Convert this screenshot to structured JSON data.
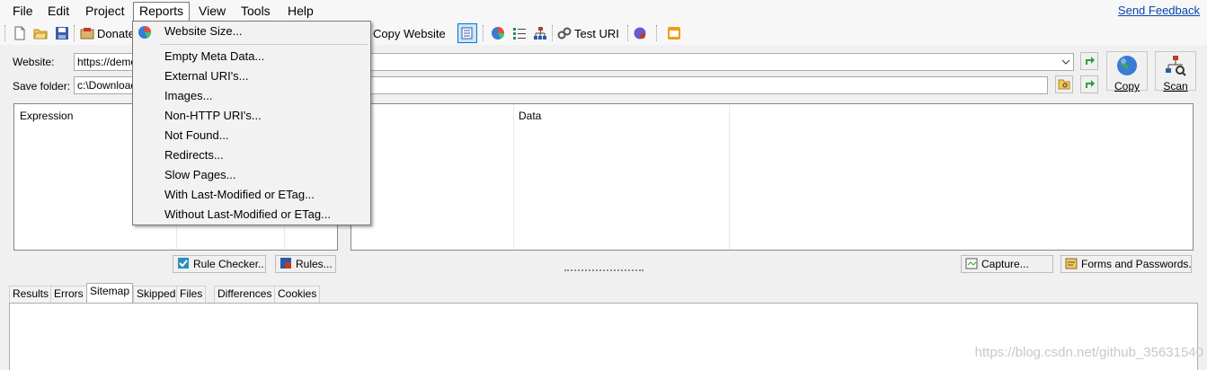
{
  "menubar": {
    "items": [
      "File",
      "Edit",
      "Project",
      "Reports",
      "View",
      "Tools",
      "Help"
    ],
    "feedback": "Send Feedback"
  },
  "toolbar": {
    "donate": "Donate",
    "copy_website": "Copy Website",
    "test_uri": "Test URI"
  },
  "form": {
    "website_label": "Website:",
    "website_value": "https://demo",
    "save_folder_label": "Save folder:",
    "save_folder_value": "c:\\Downloade",
    "copy_label": "Copy",
    "scan_label": "Scan"
  },
  "left_pane": {
    "col_expression": "Expression"
  },
  "right_pane": {
    "col_data": "Data"
  },
  "buttons": {
    "rule_checker": "Rule Checker...",
    "rules": "Rules...",
    "capture": "Capture...",
    "forms_passwords": "Forms and Passwords..."
  },
  "tabs": [
    "Results",
    "Errors",
    "Sitemap",
    "Skipped",
    "Files",
    "Differences",
    "Cookies"
  ],
  "active_tab": "Sitemap",
  "reports_menu": {
    "items": [
      "Website Size...",
      "Empty Meta Data...",
      "External URI's...",
      "Images...",
      "Non-HTTP URI's...",
      "Not Found...",
      "Redirects...",
      "Slow Pages...",
      "With Last-Modified or ETag...",
      "Without Last-Modified or ETag..."
    ]
  },
  "watermark": "https://blog.csdn.net/github_35631540",
  "colors": {
    "link": "#0645ad",
    "accent": "#0078d7"
  }
}
